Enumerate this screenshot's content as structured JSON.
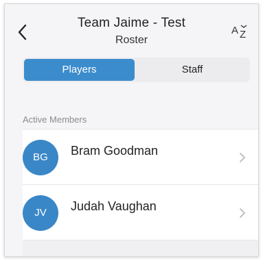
{
  "header": {
    "title": "Team Jaime - Test",
    "subtitle": "Roster",
    "back_icon": "chevron-left-icon",
    "sort_icon": "sort-az-icon"
  },
  "tabs": [
    {
      "label": "Players",
      "active": true
    },
    {
      "label": "Staff",
      "active": false
    }
  ],
  "section": {
    "label": "Active Members"
  },
  "members": [
    {
      "initials": "BG",
      "name": "Bram Goodman"
    },
    {
      "initials": "JV",
      "name": "Judah Vaughan"
    }
  ],
  "colors": {
    "accent": "#3b8ccc",
    "avatar": "#3a87c7"
  }
}
